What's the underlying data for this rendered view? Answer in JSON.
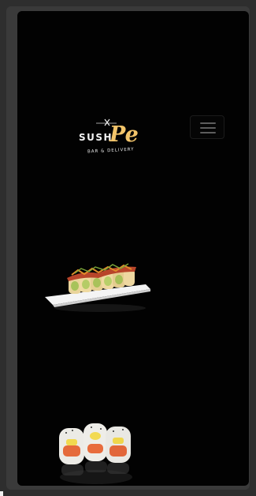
{
  "brand": {
    "name_part1": "SUSHI",
    "name_part2": "Pe",
    "tagline": "BAR & DELIVERY"
  },
  "icons": {
    "menu": "hamburger-menu-icon",
    "logo_mark": "chopsticks-icon"
  },
  "images": {
    "dish_1": "sushi-roll-platter-image",
    "dish_2": "sushi-maki-rolls-image"
  },
  "colors": {
    "background": "#020202",
    "logo_accent": "#f2c46a",
    "logo_text": "#f2f2f2"
  }
}
